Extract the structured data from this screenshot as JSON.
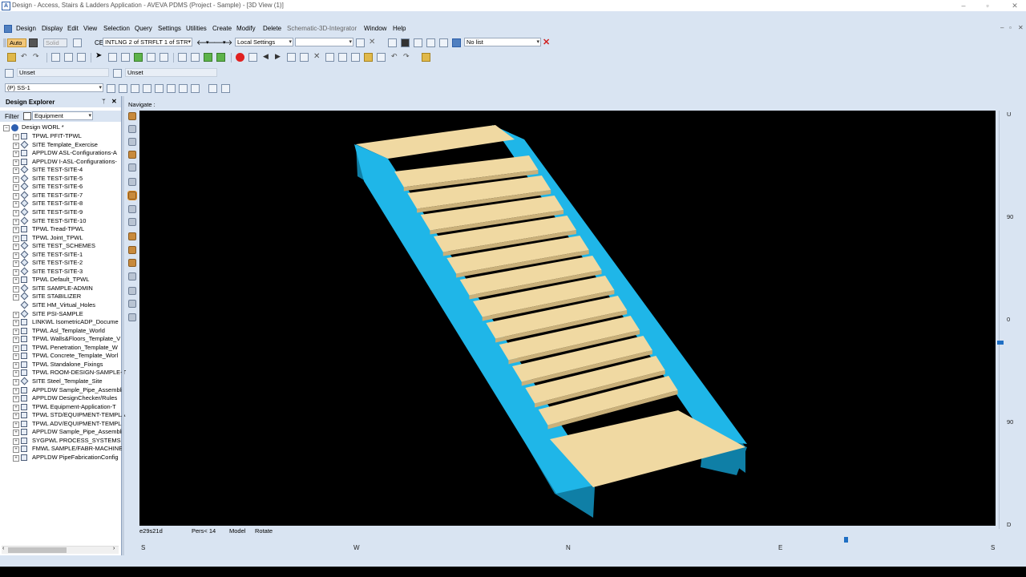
{
  "window": {
    "title": "Design - Access, Stairs & Ladders Application  -  AVEVA PDMS (Project - Sample) - [3D View (1)]",
    "app_icon": "A",
    "controls": [
      "–",
      "▫",
      "✕"
    ]
  },
  "menubar": {
    "items": [
      "Design",
      "Display",
      "Edit",
      "View",
      "Selection",
      "Query",
      "Settings",
      "Utilities",
      "Create",
      "Modify",
      "Delete",
      "Schematic-3D-Integrator",
      "Window",
      "Help"
    ],
    "mdi_controls": [
      "–",
      "▫",
      "✕"
    ]
  },
  "toolbar1": {
    "auto_label": "Auto",
    "solid_label": "Solid",
    "ce_label": "CE",
    "ce_value": "INTLNG 2 of STRFLT 1 of STR",
    "settings_value": "Local Settings",
    "empty_combo": "",
    "list_value": "No list"
  },
  "toolbar3": {
    "left_field": "Unset",
    "right_field": "Unset"
  },
  "toolbar4": {
    "ss_value": "(P) SS-1"
  },
  "explorer": {
    "title": "Design Explorer",
    "pin": "ᛘ",
    "close": "✕",
    "filter_label": "Filter",
    "filter_value": "Equipment",
    "root": "Design WORL *",
    "items": [
      {
        "label": "TPWL PFIT-TPWL",
        "icon": "tpwl"
      },
      {
        "label": "SITE Template_Exercise",
        "icon": "site"
      },
      {
        "label": "APPLDW ASL-Configurations-A",
        "icon": "appldw"
      },
      {
        "label": "APPLDW I-ASL-Configurations-",
        "icon": "appldw"
      },
      {
        "label": "SITE TEST-SITE-4",
        "icon": "site"
      },
      {
        "label": "SITE TEST-SITE-5",
        "icon": "site"
      },
      {
        "label": "SITE TEST-SITE-6",
        "icon": "site"
      },
      {
        "label": "SITE TEST-SITE-7",
        "icon": "site"
      },
      {
        "label": "SITE TEST-SITE-8",
        "icon": "site"
      },
      {
        "label": "SITE TEST-SITE-9",
        "icon": "site"
      },
      {
        "label": "SITE TEST-SITE-10",
        "icon": "site"
      },
      {
        "label": "TPWL Tread-TPWL",
        "icon": "tpwl"
      },
      {
        "label": "TPWL Joint_TPWL",
        "icon": "tpwl"
      },
      {
        "label": "SITE TEST_SCHEMES",
        "icon": "site"
      },
      {
        "label": "SITE TEST-SITE-1",
        "icon": "site"
      },
      {
        "label": "SITE TEST-SITE-2",
        "icon": "site"
      },
      {
        "label": "SITE TEST-SITE-3",
        "icon": "site"
      },
      {
        "label": "TPWL Default_TPWL",
        "icon": "tpwl"
      },
      {
        "label": "SITE SAMPLE-ADMIN",
        "icon": "site"
      },
      {
        "label": "SITE STABILIZER",
        "icon": "site"
      },
      {
        "label": "SITE HM_Virtual_Holes",
        "icon": "site"
      },
      {
        "label": "SITE PSI-SAMPLE",
        "icon": "site"
      },
      {
        "label": "LINKWL IsometricADP_Docume",
        "icon": "tpwl"
      },
      {
        "label": "TPWL Asl_Template_World",
        "icon": "tpwl"
      },
      {
        "label": "TPWL Walls&Floors_Template_V",
        "icon": "tpwl"
      },
      {
        "label": "TPWL Penetration_Template_W",
        "icon": "tpwl"
      },
      {
        "label": "TPWL Concrete_Template_Worl",
        "icon": "tpwl"
      },
      {
        "label": "TPWL Standalone_Fixings",
        "icon": "tpwl"
      },
      {
        "label": "TPWL ROOM-DESIGN-SAMPLE-T",
        "icon": "tpwl"
      },
      {
        "label": "SITE Steel_Template_Site",
        "icon": "site"
      },
      {
        "label": "APPLDW Sample_Pipe_Assembli",
        "icon": "appldw"
      },
      {
        "label": "APPLDW DesignChecker/Rules",
        "icon": "appldw"
      },
      {
        "label": "TPWL Equipment-Application-T",
        "icon": "tpwl"
      },
      {
        "label": "TPWL STD/EQUIPMENT-TEMPLA",
        "icon": "tpwl"
      },
      {
        "label": "TPWL ADV/EQUIPMENT-TEMPL",
        "icon": "tpwl"
      },
      {
        "label": "APPLDW Sample_Pipe_Assembli",
        "icon": "appldw"
      },
      {
        "label": "SYGPWL PROCESS_SYSTEMS",
        "icon": "tpwl"
      },
      {
        "label": "FMWL SAMPLE/FABR-MACHINE",
        "icon": "tpwl"
      },
      {
        "label": "APPLDW PipeFabricationConfig",
        "icon": "appldw"
      }
    ]
  },
  "view": {
    "navigate_label": "Navigate :",
    "status": {
      "code": "e29s21d",
      "pers": "Pers< 14",
      "mode": "Model",
      "action": "Rotate"
    },
    "compass": [
      "S",
      "W",
      "N",
      "E",
      "S"
    ],
    "elevation_scale": [
      "U",
      "90",
      "0",
      "90",
      "D"
    ]
  },
  "colors": {
    "beam": "#1fb6e8",
    "beam_dark": "#0f7fa6",
    "tread": "#f0d9a2",
    "tread_side": "#c9b07a",
    "background": "#000000",
    "chrome": "#d9e4f2"
  }
}
